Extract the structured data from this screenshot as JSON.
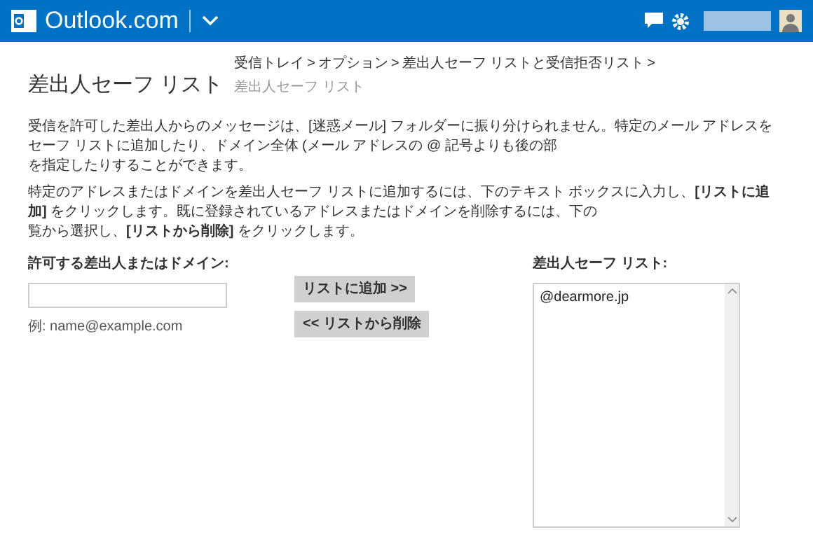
{
  "header": {
    "brand": "Outlook.com"
  },
  "page": {
    "title": "差出人セーフ リスト",
    "breadcrumb": [
      {
        "label": "受信トレイ",
        "current": false
      },
      {
        "label": "オプション",
        "current": false
      },
      {
        "label": "差出人セーフ リストと受信拒否リスト",
        "current": false
      },
      {
        "label": "差出人セーフ リスト",
        "current": true
      }
    ],
    "separator": ">"
  },
  "paragraphs": [
    {
      "lines": [
        "受信を許可した差出人からのメッセージは、[迷惑メール] フォルダーに振り分けられません。特定のメール アドレスをセーフ リストに追加したり、ドメイン全体 (メール アドレスの @ 記号よりも後の部",
        "を指定したりすることができます。"
      ]
    },
    {
      "lines": [
        "特定のアドレスまたはドメインを差出人セーフ リストに追加するには、下のテキスト ボックスに入力し、**[リストに追加]** をクリックします。既に登録されているアドレスまたはドメインを削除するには、下の",
        "覧から選択し、**[リストから削除]** をクリックします。"
      ]
    }
  ],
  "form": {
    "input_label": "許可する差出人またはドメイン:",
    "hint": "例: name@example.com",
    "buttons": [
      "リストに追加 >>",
      "<< リストから削除"
    ],
    "list_label": "差出人セーフ リスト:",
    "list_items": [
      {
        "text": "@dearmore.jp",
        "selected": false
      }
    ]
  }
}
